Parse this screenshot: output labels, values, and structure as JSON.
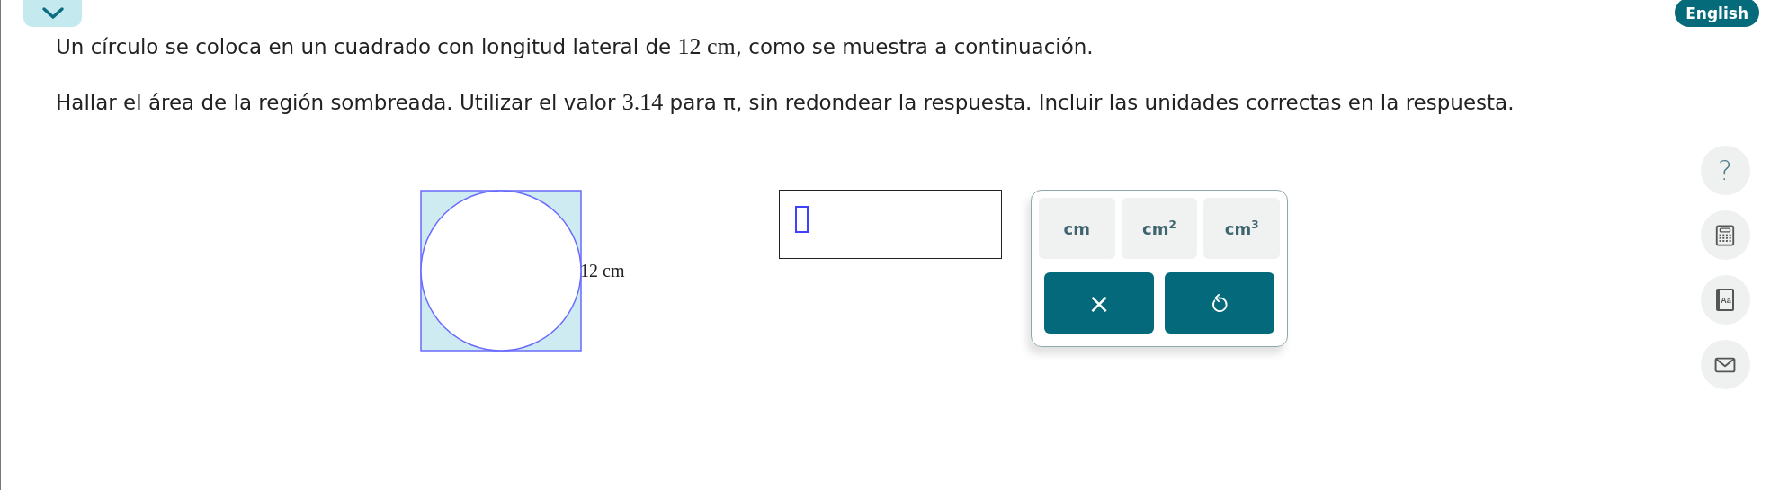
{
  "header": {
    "language_button": "English"
  },
  "question": [
    {
      "segments": [
        {
          "kind": "text",
          "text": "Un círculo se coloca en un cuadrado con longitud lateral de "
        },
        {
          "kind": "math",
          "text": "12 cm"
        },
        {
          "kind": "text",
          "text": ", como se muestra a continuación."
        }
      ]
    },
    {
      "segments": [
        {
          "kind": "text",
          "text": "Hallar el área de la región sombreada. Utilizar el valor "
        },
        {
          "kind": "math",
          "text": "3.14"
        },
        {
          "kind": "text",
          "text": " para π, sin redondear la respuesta. Incluir las unidades correctas en la respuesta."
        }
      ]
    }
  ],
  "figure": {
    "side_label": "12 cm"
  },
  "keypad": {
    "unit_keys": [
      "cm",
      "cm$^{2}$",
      "cm$^{3}$"
    ],
    "actions": [
      {
        "kind": "clear",
        "label": "×"
      },
      {
        "kind": "undo"
      }
    ]
  },
  "sidebar": [
    {
      "kind": "help",
      "label": "?"
    },
    {
      "kind": "calculator"
    },
    {
      "kind": "dictionary",
      "label": "Aa"
    },
    {
      "kind": "mail"
    }
  ]
}
